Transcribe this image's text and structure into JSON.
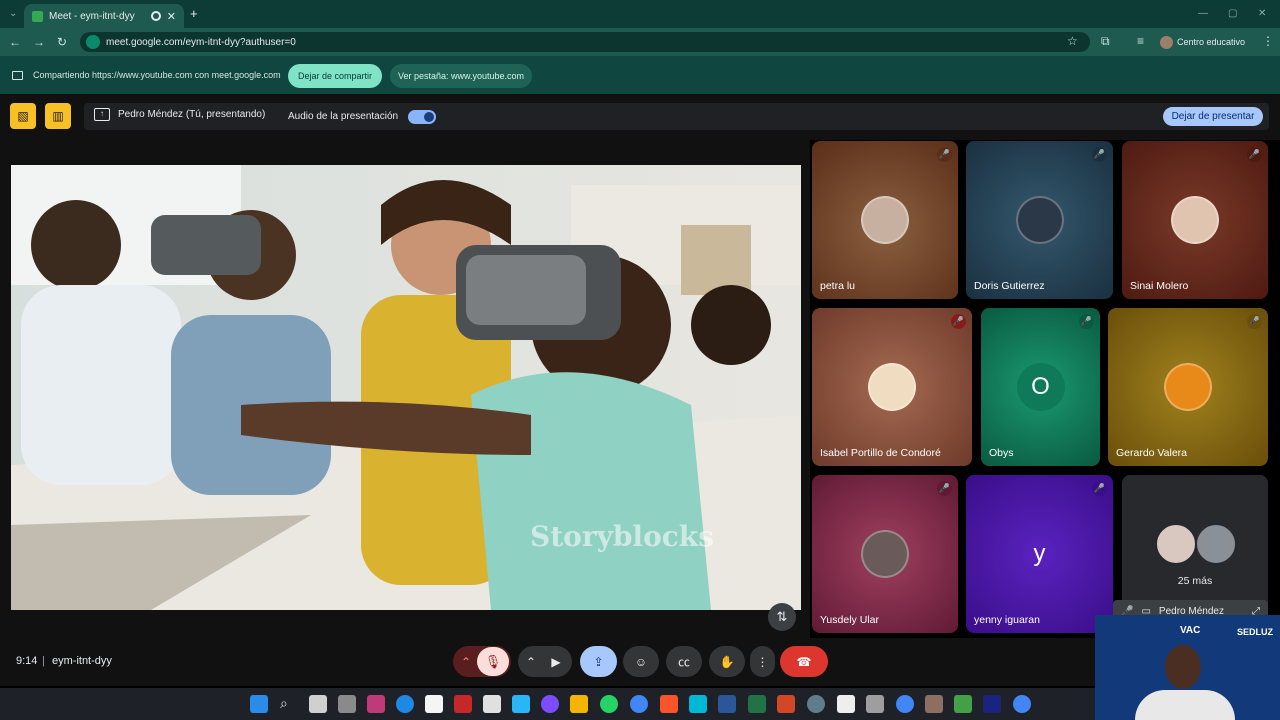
{
  "browser": {
    "tab_title": "Meet - eym-itnt-dyy",
    "new_tab": "+",
    "url": "meet.google.com/eym-itnt-dyy?authuser=0",
    "profile_name": "Centro educativo",
    "window_controls": [
      "—",
      "▢",
      "✕"
    ]
  },
  "share_banner": {
    "text": "Compartiendo https://www.youtube.com con meet.google.com",
    "stop_label": "Dejar de compartir",
    "view_tab_label": "Ver pestaña: www.youtube.com"
  },
  "meet_header": {
    "presenter": "Pedro Méndez (Tú, presentando)",
    "audio_label": "Audio de la presentación",
    "audio_on": true,
    "stop_presenting_label": "Dejar de presentar"
  },
  "stage": {
    "watermark": "Storyblocks"
  },
  "participants": [
    {
      "name": "petra lu",
      "muted": true,
      "bg": "#7a4a2a"
    },
    {
      "name": "Doris Gutierrez",
      "muted": true,
      "bg": "#2a4a6a"
    },
    {
      "name": "Sinai Molero",
      "muted": true,
      "bg": "#6a2a1e"
    },
    {
      "name": "Isabel Portillo de Condoré",
      "muted": true,
      "bg": "#8a4a3a"
    },
    {
      "name": "Obys",
      "muted": true,
      "bg": "#0e6e52",
      "letter": "O"
    },
    {
      "name": "Gerardo Valera",
      "muted": true,
      "bg": "#7a5a14"
    },
    {
      "name": "Yusdely Ular",
      "muted": true,
      "bg": "#7a2a4a"
    },
    {
      "name": "yenny iguaran",
      "muted": true,
      "bg": "#4a1a9a",
      "letter": "y"
    },
    {
      "name": "Pedro Méndez",
      "more_label": "25 más"
    }
  ],
  "bottom": {
    "time": "9:14",
    "separator": "|",
    "meeting_code": "eym-itnt-dyy"
  },
  "selfie": {
    "logos": [
      "VAC",
      "SEDLUZ"
    ]
  },
  "icons": [
    "mic-off-icon",
    "camera-icon",
    "present-icon",
    "emoji-icon",
    "captions-icon",
    "hand-icon",
    "more-icon",
    "hangup-icon"
  ]
}
